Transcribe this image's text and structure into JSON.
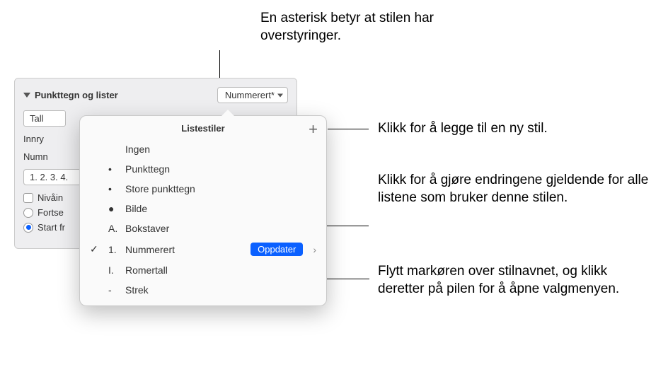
{
  "callouts": {
    "asterisk": "En asterisk betyr at stilen har overstyringer.",
    "add": "Klikk for å legge til en ny stil.",
    "update": "Klikk for å gjøre endringene gjeldende for alle listene som bruker denne stilen.",
    "arrow": "Flytt markøren over stilnavnet, og klikk deretter på pilen for å åpne valgmenyen."
  },
  "panel": {
    "title": "Punkttegn og lister",
    "style_select": "Nummerert*",
    "number_format_select": "Tall",
    "indent_label": "Innry",
    "numbers_label": "Numn",
    "hierarchy_select": "1. 2. 3. 4.",
    "level_checkbox_label": "Nivåin",
    "radio_continue": "Fortse",
    "radio_start": "Start fr"
  },
  "popover": {
    "title": "Listestiler",
    "items": [
      {
        "prefix": "",
        "label": "Ingen"
      },
      {
        "prefix": "•",
        "label": "Punkttegn"
      },
      {
        "prefix": "•",
        "label": "Store punkttegn"
      },
      {
        "prefix": "●",
        "label": "Bilde"
      },
      {
        "prefix": "A.",
        "label": "Bokstaver"
      },
      {
        "prefix": "1.",
        "label": "Nummerert",
        "selected": true
      },
      {
        "prefix": "I.",
        "label": "Romertall"
      },
      {
        "prefix": "-",
        "label": "Strek"
      }
    ],
    "update_button": "Oppdater"
  }
}
